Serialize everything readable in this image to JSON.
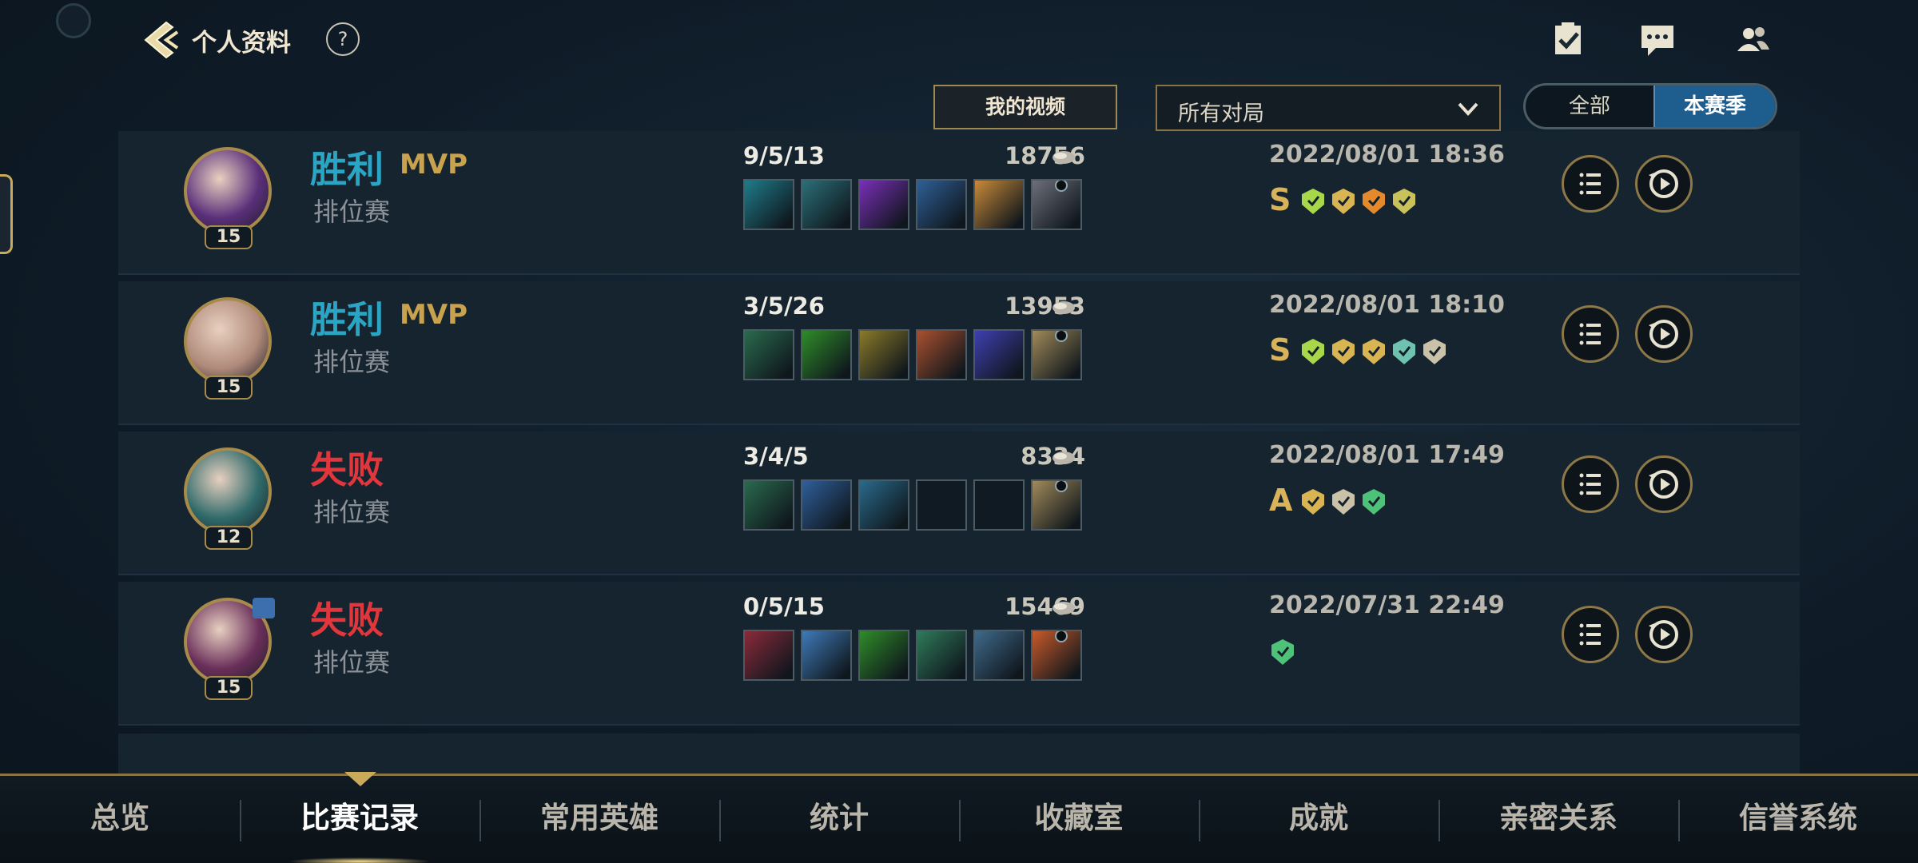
{
  "header": {
    "title": "个人资料",
    "help_glyph": "?",
    "back_icon": "back-chevron-icon",
    "icons": [
      "checklist-icon",
      "chat-icon",
      "friends-icon"
    ]
  },
  "filters": {
    "my_video_label": "我的视频",
    "match_filter_value": "所有对局",
    "segment_all": "全部",
    "segment_season": "本赛季",
    "segment_selected": "本赛季"
  },
  "matches": [
    {
      "result": "胜利",
      "result_type": "win",
      "mvp": "MVP",
      "queue": "排位赛",
      "level": "15",
      "kda": "9/5/13",
      "gold": "18756",
      "date": "2022/08/01 18:36",
      "grade": "S",
      "avatar_color": "#5a2f7a",
      "items": [
        "#1f7c8a",
        "#2c6f78",
        "#7a2fb8",
        "#2f5f96",
        "#c88a3a",
        "#6d6f7a"
      ],
      "badges": [
        "#a8d84a",
        "#d8b552",
        "#e58a2c",
        "#c9c25a"
      ]
    },
    {
      "result": "胜利",
      "result_type": "win",
      "mvp": "MVP",
      "queue": "排位赛",
      "level": "15",
      "kda": "3/5/26",
      "gold": "13953",
      "date": "2022/08/01 18:10",
      "grade": "S",
      "avatar_color": "#b08a7a",
      "items": [
        "#2a6a4e",
        "#2f8c2a",
        "#8a7a2a",
        "#a8502f",
        "#3f3fb0",
        "#a08a5a"
      ],
      "badges": [
        "#a8d84a",
        "#d8b552",
        "#d8b552",
        "#6fc2b0",
        "#c9c2a8"
      ]
    },
    {
      "result": "失败",
      "result_type": "loss",
      "mvp": "",
      "queue": "排位赛",
      "level": "12",
      "kda": "3/4/5",
      "gold": "8334",
      "date": "2022/08/01 17:49",
      "grade": "A",
      "avatar_color": "#2f6a6a",
      "items": [
        "#2a6a4e",
        "#2f5f9a",
        "#2a6a8a",
        "",
        "",
        "#a08a5a"
      ],
      "badges": [
        "#d8b552",
        "#c9c2a8",
        "#4fc27a"
      ]
    },
    {
      "result": "失败",
      "result_type": "loss",
      "mvp": "",
      "queue": "排位赛",
      "level": "15",
      "kda": "0/5/15",
      "gold": "15469",
      "date": "2022/07/31 22:49",
      "grade": "",
      "avatar_color": "#6a2f5a",
      "party": true,
      "items": [
        "#8a2a3a",
        "#3f7ab8",
        "#2f8c2a",
        "#2f7a5a",
        "#3f6a8a",
        "#c85a2a"
      ],
      "badges": [
        "#4fc27a"
      ]
    }
  ],
  "bottom_nav": [
    "总览",
    "比赛记录",
    "常用英雄",
    "统计",
    "收藏室",
    "成就",
    "亲密关系",
    "信誉系统"
  ],
  "bottom_nav_active": "比赛记录"
}
